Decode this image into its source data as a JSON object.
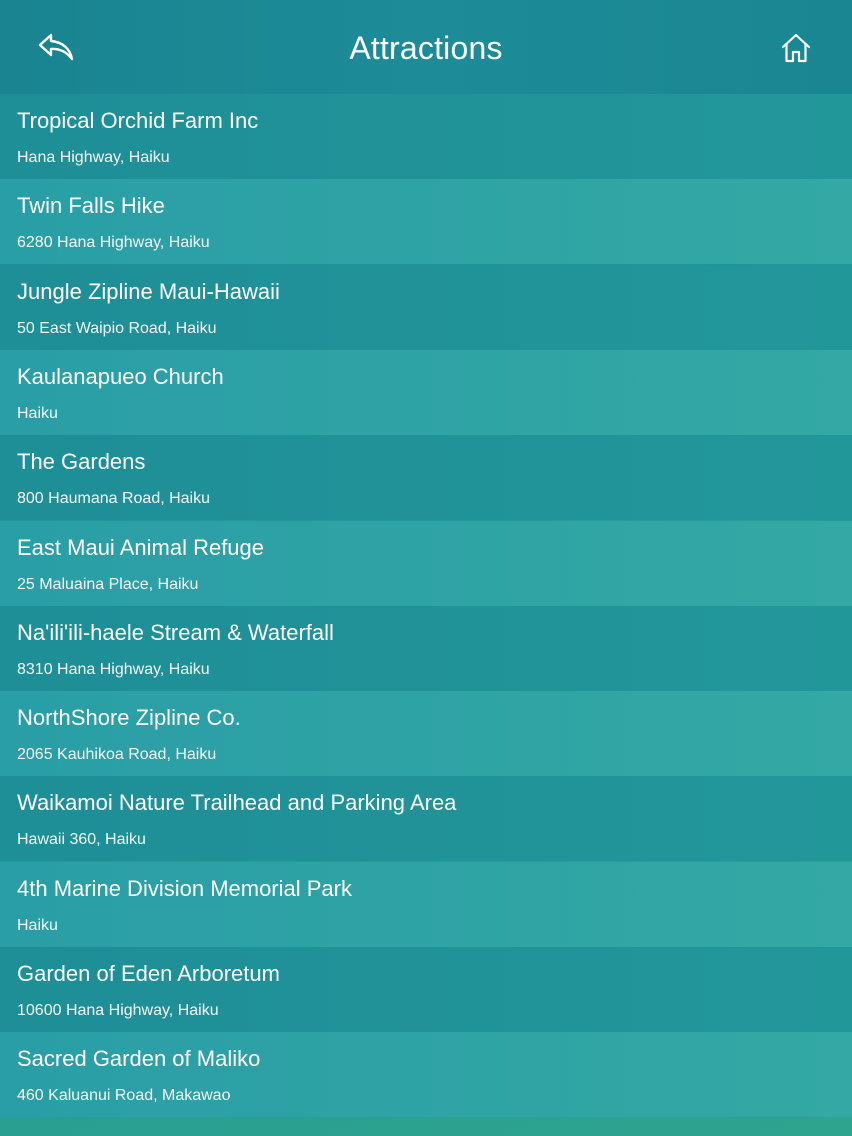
{
  "header": {
    "title": "Attractions",
    "back_icon": "back-arrow-icon",
    "home_icon": "home-icon"
  },
  "colors": {
    "row_light": "#2d9ea6",
    "row_dark": "#1f8e93"
  },
  "attractions": [
    {
      "name": "Tropical Orchid Farm Inc",
      "address": "Hana Highway, Haiku"
    },
    {
      "name": "Twin Falls Hike",
      "address": "6280 Hana Highway, Haiku"
    },
    {
      "name": "Jungle Zipline Maui-Hawaii",
      "address": "50 East Waipio Road, Haiku"
    },
    {
      "name": "Kaulanapueo Church",
      "address": "Haiku"
    },
    {
      "name": "The Gardens",
      "address": "800 Haumana Road, Haiku"
    },
    {
      "name": "East Maui Animal Refuge",
      "address": "25 Maluaina Place, Haiku"
    },
    {
      "name": "Na'ili'ili-haele Stream & Waterfall",
      "address": "8310 Hana Highway, Haiku"
    },
    {
      "name": "NorthShore Zipline Co.",
      "address": "2065 Kauhikoa Road, Haiku"
    },
    {
      "name": "Waikamoi Nature Trailhead and Parking Area",
      "address": "Hawaii 360, Haiku"
    },
    {
      "name": "4th Marine Division Memorial Park",
      "address": "Haiku"
    },
    {
      "name": "Garden of Eden Arboretum",
      "address": "10600 Hana Highway, Haiku"
    },
    {
      "name": "Sacred Garden of Maliko",
      "address": "460 Kaluanui Road, Makawao"
    }
  ]
}
